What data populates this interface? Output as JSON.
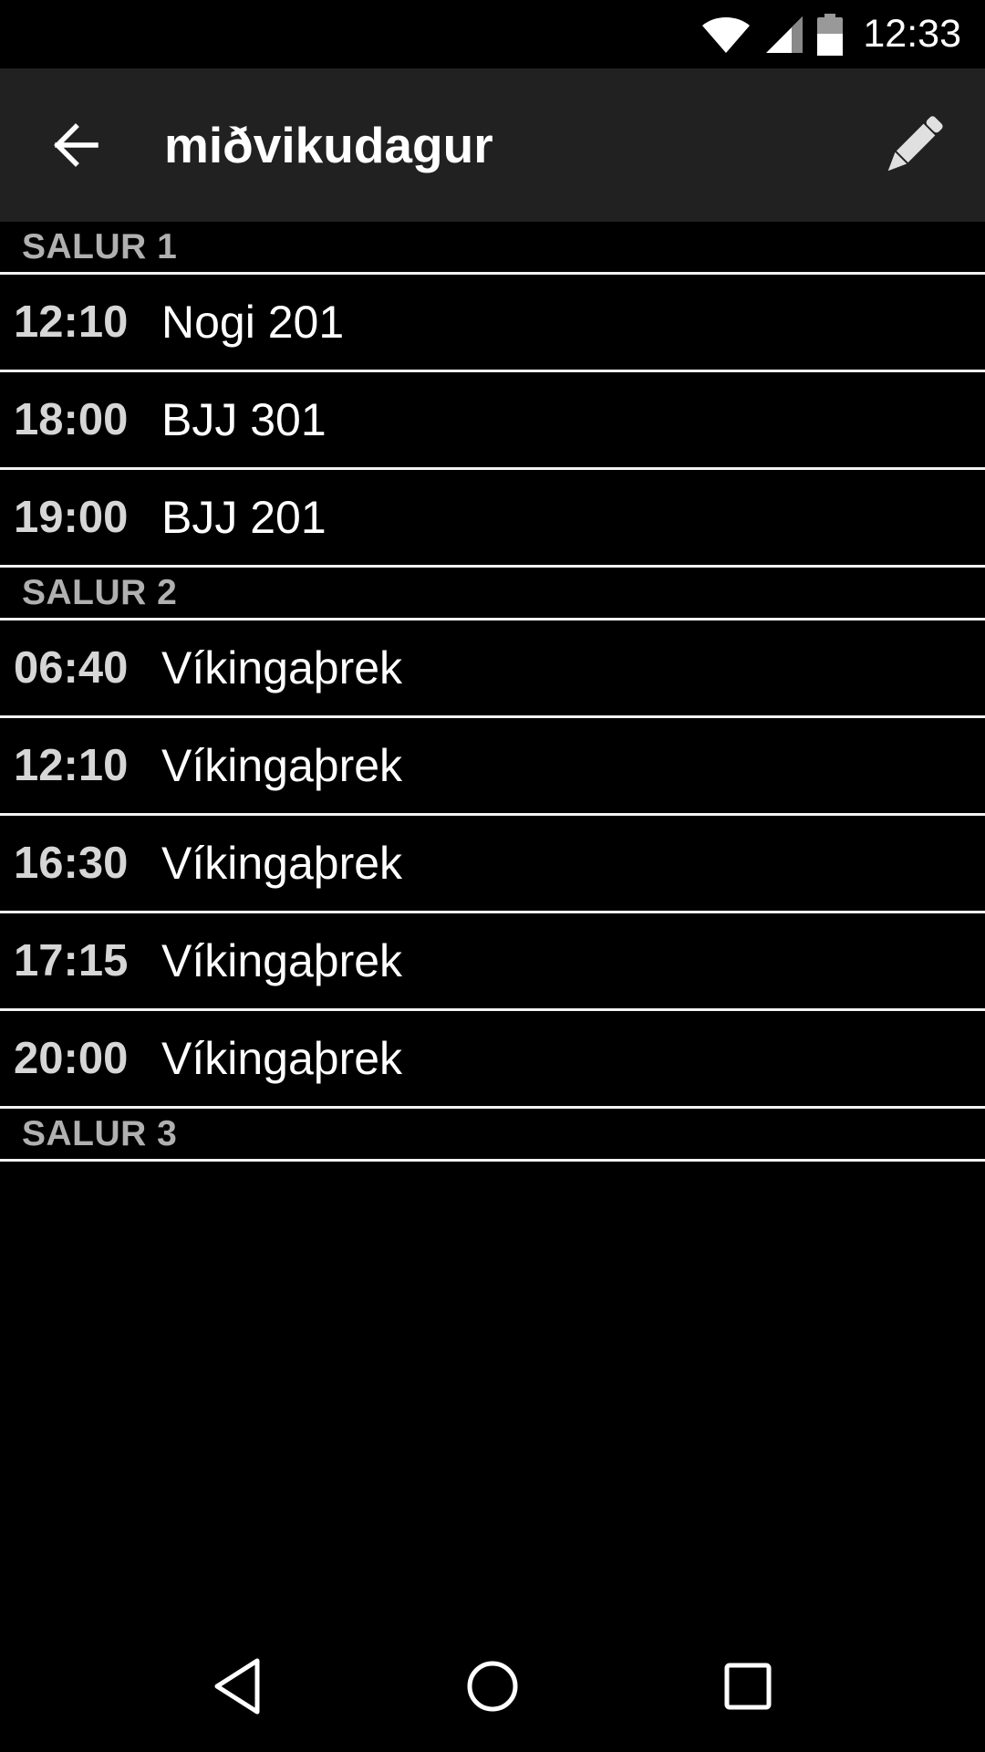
{
  "status_bar": {
    "time": "12:33",
    "icons": [
      "wifi-icon",
      "signal-icon",
      "battery-icon"
    ]
  },
  "app_bar": {
    "title": "miðvikudagur",
    "back_icon": "arrow-back-icon",
    "edit_icon": "pencil-icon"
  },
  "sections": [
    {
      "header": "SALUR 1",
      "items": [
        {
          "time": "12:10",
          "name": "Nogi 201"
        },
        {
          "time": "18:00",
          "name": "BJJ 301"
        },
        {
          "time": "19:00",
          "name": "BJJ 201"
        }
      ]
    },
    {
      "header": "SALUR 2",
      "items": [
        {
          "time": "06:40",
          "name": "Víkingaþrek"
        },
        {
          "time": "12:10",
          "name": "Víkingaþrek"
        },
        {
          "time": "16:30",
          "name": "Víkingaþrek"
        },
        {
          "time": "17:15",
          "name": "Víkingaþrek"
        },
        {
          "time": "20:00",
          "name": "Víkingaþrek"
        }
      ]
    },
    {
      "header": "SALUR 3",
      "items": []
    }
  ],
  "nav_bar": {
    "icons": [
      "back-triangle-icon",
      "home-circle-icon",
      "recents-square-icon"
    ]
  },
  "colors": {
    "background": "#000000",
    "app_bar": "#212121",
    "divider": "#f2f2f2",
    "section_header_text": "#b0b0b0",
    "time_text": "#d6d6d6"
  }
}
